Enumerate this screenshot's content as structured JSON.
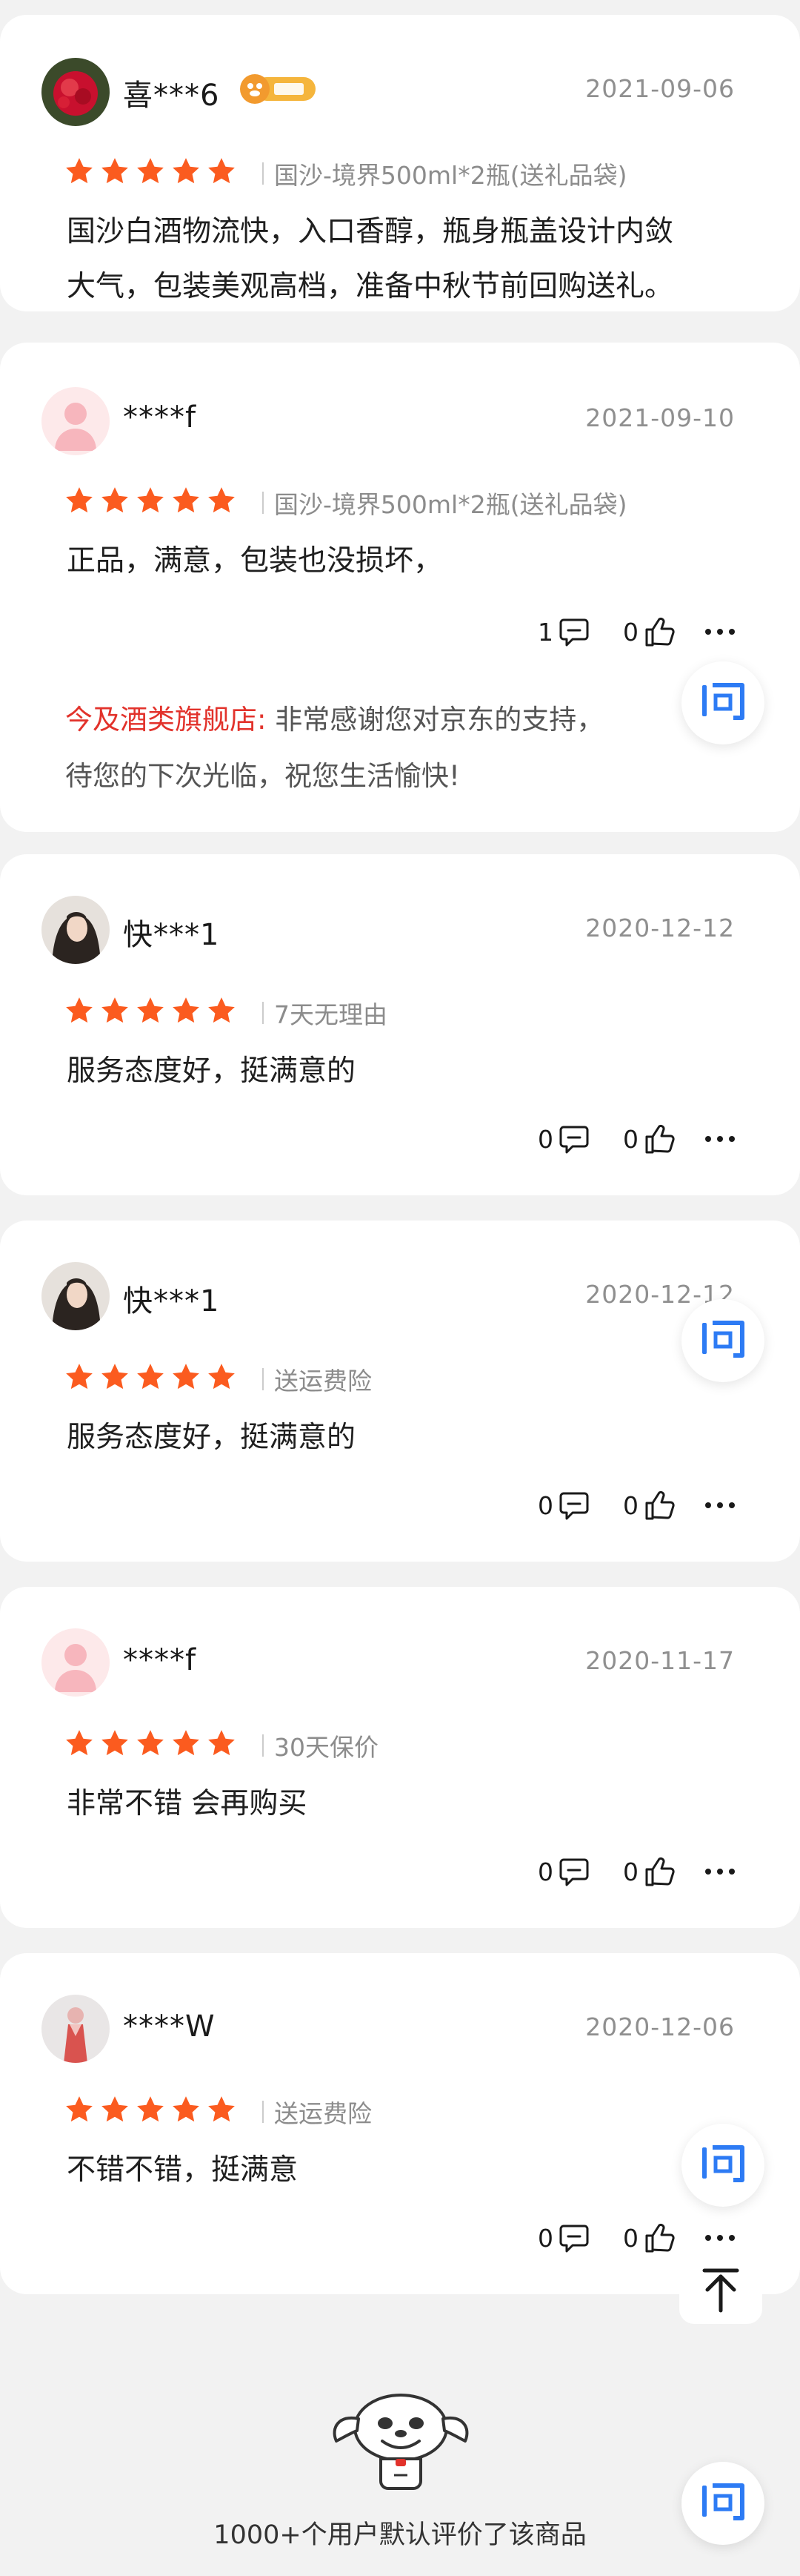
{
  "colors": {
    "star": "#fb5b1f",
    "reply_shop": "#e2322b",
    "ask_icon": "#2d7bf4",
    "page_bg": "#f2f2f2"
  },
  "reviews": [
    {
      "username": "喜***6",
      "badge": "plus",
      "date": "2021-09-06",
      "rating": 5,
      "spec": "国沙-境界500ml*2瓶(送礼品袋)",
      "text_lines": [
        "国沙白酒物流快，入口香醇，瓶身瓶盖设计内敛",
        "大气，包装美观高档，准备中秋节前回购送礼。"
      ]
    },
    {
      "username": "****f",
      "date": "2021-09-10",
      "rating": 5,
      "spec": "国沙-境界500ml*2瓶(送礼品袋)",
      "text_lines": [
        "正品，满意，包装也没损坏，"
      ],
      "comments": "1",
      "likes": "0",
      "reply_shop": "今及酒类旗舰店:",
      "reply_lines": [
        " 非常感谢您对京东的支持，",
        "待您的下次光临，祝您生活愉快!"
      ]
    },
    {
      "username": "快***1",
      "date": "2020-12-12",
      "rating": 5,
      "spec": "7天无理由",
      "text_lines": [
        "服务态度好，挺满意的"
      ],
      "comments": "0",
      "likes": "0"
    },
    {
      "username": "快***1",
      "date": "2020-12-12",
      "rating": 5,
      "spec": "送运费险",
      "text_lines": [
        "服务态度好，挺满意的"
      ],
      "comments": "0",
      "likes": "0"
    },
    {
      "username": "****f",
      "date": "2020-11-17",
      "rating": 5,
      "spec": "30天保价",
      "text_lines": [
        "非常不错 会再购买"
      ],
      "comments": "0",
      "likes": "0"
    },
    {
      "username": "****W",
      "date": "2020-12-06",
      "rating": 5,
      "spec": "送运费险",
      "text_lines": [
        "不错不错，挺满意"
      ],
      "comments": "0",
      "likes": "0"
    }
  ],
  "icons": {
    "ask": "ask-icon",
    "comment": "comment-bubble-icon",
    "like": "thumb-up-icon",
    "more": "more-dots-icon",
    "top": "back-to-top-icon",
    "mascot": "jd-dog-mascot-icon"
  },
  "footer": {
    "summary": "1000+个用户默认评价了该商品"
  }
}
